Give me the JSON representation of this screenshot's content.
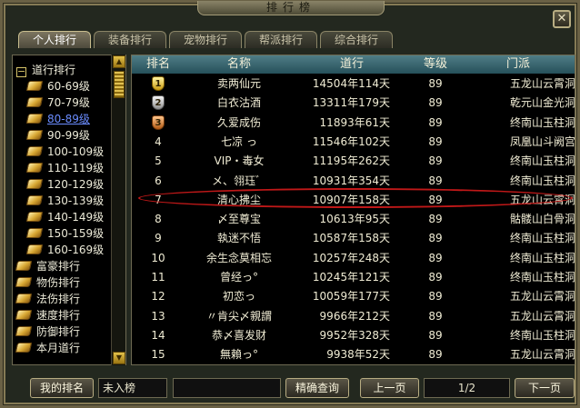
{
  "window": {
    "title": "排行榜",
    "close_icon": "✕"
  },
  "tabs": [
    {
      "label": "个人排行",
      "active": true
    },
    {
      "label": "装备排行",
      "active": false
    },
    {
      "label": "宠物排行",
      "active": false
    },
    {
      "label": "帮派排行",
      "active": false
    },
    {
      "label": "综合排行",
      "active": false
    }
  ],
  "sidebar": {
    "group_label": "道行排行",
    "sub_items": [
      "60-69级",
      "70-79级",
      "80-89级",
      "90-99级",
      "100-109级",
      "110-119级",
      "120-129级",
      "130-139级",
      "140-149级",
      "150-159级",
      "160-169级"
    ],
    "selected_sub": "80-89级",
    "top_items": [
      "富豪排行",
      "物伤排行",
      "法伤排行",
      "速度排行",
      "防御排行",
      "本月道行"
    ]
  },
  "table": {
    "headers": {
      "rank": "排名",
      "name": "名称",
      "dao": "道行",
      "level": "等级",
      "sect": "门派"
    },
    "rows": [
      {
        "rank": "1",
        "medal": "gold",
        "name": "卖两仙元",
        "dao": "14504年114天",
        "level": "89",
        "sect": "五龙山云霄洞"
      },
      {
        "rank": "2",
        "medal": "silver",
        "name": "白衣沽酒",
        "dao": "13311年179天",
        "level": "89",
        "sect": "乾元山金光洞"
      },
      {
        "rank": "3",
        "medal": "bronze",
        "name": "久爱成伤",
        "dao": "11893年61天",
        "level": "89",
        "sect": "终南山玉柱洞"
      },
      {
        "rank": "4",
        "name": "七凉 っ",
        "dao": "11546年102天",
        "level": "89",
        "sect": "凤凰山斗阙宫"
      },
      {
        "rank": "5",
        "name": "VIP・毒女",
        "dao": "11195年262天",
        "level": "89",
        "sect": "终南山玉柱洞"
      },
      {
        "rank": "6",
        "name": "メ、翎珏゛",
        "dao": "10931年354天",
        "level": "89",
        "sect": "终南山玉柱洞"
      },
      {
        "rank": "7",
        "name": "清心拂尘",
        "dao": "10907年158天",
        "level": "89",
        "sect": "五龙山云霄洞"
      },
      {
        "rank": "8",
        "name": "〆至尊宝",
        "dao": "10613年95天",
        "level": "89",
        "sect": "骷髅山白骨洞"
      },
      {
        "rank": "9",
        "name": "執迷不悟",
        "dao": "10587年158天",
        "level": "89",
        "sect": "终南山玉柱洞"
      },
      {
        "rank": "10",
        "name": "余生念莫相忘",
        "dao": "10257年248天",
        "level": "89",
        "sect": "终南山玉柱洞"
      },
      {
        "rank": "11",
        "name": "曾经っ°",
        "dao": "10245年121天",
        "level": "89",
        "sect": "终南山玉柱洞"
      },
      {
        "rank": "12",
        "name": "初恋っ",
        "dao": "10059年177天",
        "level": "89",
        "sect": "五龙山云霄洞"
      },
      {
        "rank": "13",
        "name": "〃肯尖〆親謂",
        "dao": "9966年212天",
        "level": "89",
        "sect": "五龙山云霄洞"
      },
      {
        "rank": "14",
        "name": "恭〆喜发财",
        "dao": "9952年328天",
        "level": "89",
        "sect": "终南山玉柱洞"
      },
      {
        "rank": "15",
        "name": "無賴っ°",
        "dao": "9938年52天",
        "level": "89",
        "sect": "五龙山云霄洞"
      }
    ],
    "highlighted_row": 7
  },
  "footer": {
    "my_rank_button": "我的排名",
    "my_rank_value": "未入榜",
    "search_input_value": "",
    "exact_search_button": "精确查询",
    "prev_button": "上一页",
    "page_indicator": "1/2",
    "next_button": "下一页"
  },
  "colors": {
    "accent_header": "#3c6a74",
    "selected_link": "#6a8cff",
    "highlight_oval": "#c01818"
  }
}
